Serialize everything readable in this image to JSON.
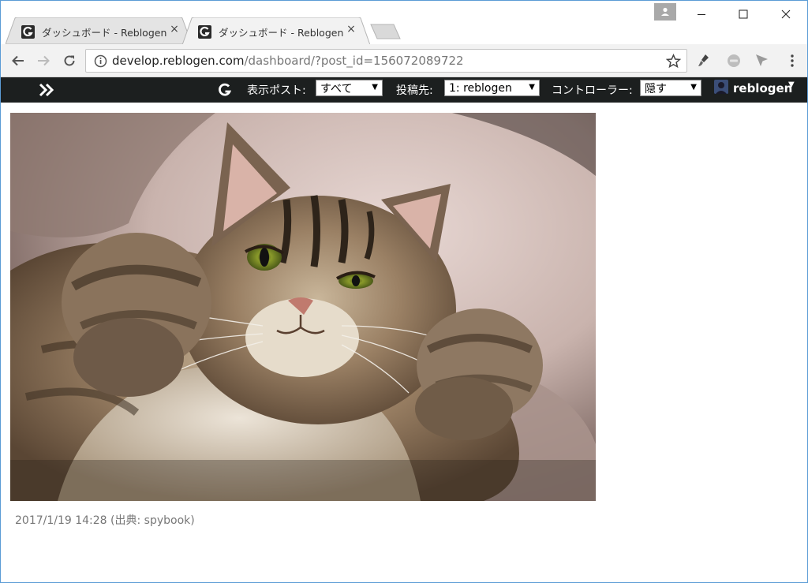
{
  "browser": {
    "tabs": [
      {
        "title": "ダッシュボード - Reblogen",
        "close": "×",
        "active": false
      },
      {
        "title": "ダッシュボード - Reblogen",
        "close": "×",
        "active": true
      }
    ],
    "url_host": "develop.reblogen.com",
    "url_path": "/dashboard/?post_id=156072089722",
    "window_controls": {
      "minimize": "minimize-icon",
      "maximize": "maximize-icon",
      "close": "close-icon"
    }
  },
  "header": {
    "post_filter_label": "表示ポスト:",
    "post_filter_value": "すべて",
    "target_label": "投稿先:",
    "target_value": "1: reblogen",
    "controller_label": "コントローラー:",
    "controller_value": "隠す",
    "username": "reblogen",
    "caret": "▼"
  },
  "post": {
    "photo": "tabby-cat-photo",
    "meta": "2017/1/19 14:28 (出典: spybook)"
  },
  "colors": {
    "header_bg": "#1c1f1f",
    "toolbar_bg": "#f2f2f2",
    "window_border": "#5b9bd5"
  }
}
